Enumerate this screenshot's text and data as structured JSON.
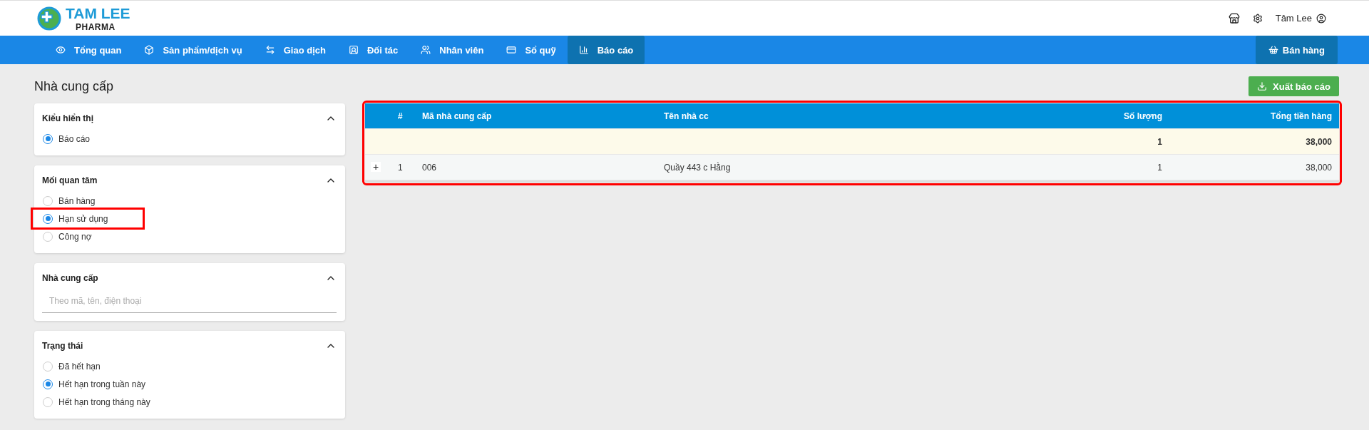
{
  "logo": {
    "name": "TAM LEE",
    "subtitle": "PHARMA"
  },
  "user": {
    "name": "Tâm Lee"
  },
  "nav": [
    {
      "label": "Tổng quan",
      "selected": false
    },
    {
      "label": "Sản phẩm/dịch vụ",
      "selected": false
    },
    {
      "label": "Giao dịch",
      "selected": false
    },
    {
      "label": "Đối tác",
      "selected": false
    },
    {
      "label": "Nhân viên",
      "selected": false
    },
    {
      "label": "Sổ quỹ",
      "selected": false
    },
    {
      "label": "Báo cáo",
      "selected": true
    }
  ],
  "sell_button": "Bán hàng",
  "page_title": "Nhà cung cấp",
  "export_button": "Xuất báo cáo",
  "filters": [
    {
      "kind": "radio",
      "title": "Kiểu hiển thị",
      "expanded": true,
      "options": [
        {
          "label": "Báo cáo",
          "selected": true,
          "highlighted": false
        }
      ]
    },
    {
      "kind": "radio",
      "title": "Mối quan tâm",
      "expanded": true,
      "options": [
        {
          "label": "Bán hàng",
          "selected": false,
          "highlighted": false
        },
        {
          "label": "Hạn sử dụng",
          "selected": true,
          "highlighted": true
        },
        {
          "label": "Công nợ",
          "selected": false,
          "highlighted": false
        }
      ]
    },
    {
      "kind": "search",
      "title": "Nhà cung cấp",
      "expanded": true,
      "placeholder": "Theo mã, tên, điện thoại"
    },
    {
      "kind": "radio",
      "title": "Trạng thái",
      "expanded": true,
      "options": [
        {
          "label": "Đã hết hạn",
          "selected": false,
          "highlighted": false
        },
        {
          "label": "Hết hạn trong tuần này",
          "selected": true,
          "highlighted": false
        },
        {
          "label": "Hết hạn trong tháng này",
          "selected": false,
          "highlighted": false
        }
      ]
    }
  ],
  "table": {
    "highlighted": true,
    "columns": [
      "#",
      "Mã nhà cung cấp",
      "Tên nhà cc",
      "Số lượng",
      "Tổng tiền hàng"
    ],
    "summary": {
      "quantity": "1",
      "total": "38,000"
    },
    "rows": [
      {
        "expand": "+",
        "index": "1",
        "code": "006",
        "name": "Quầy 443 c Hằng",
        "quantity": "1",
        "total": "38,000"
      }
    ]
  }
}
